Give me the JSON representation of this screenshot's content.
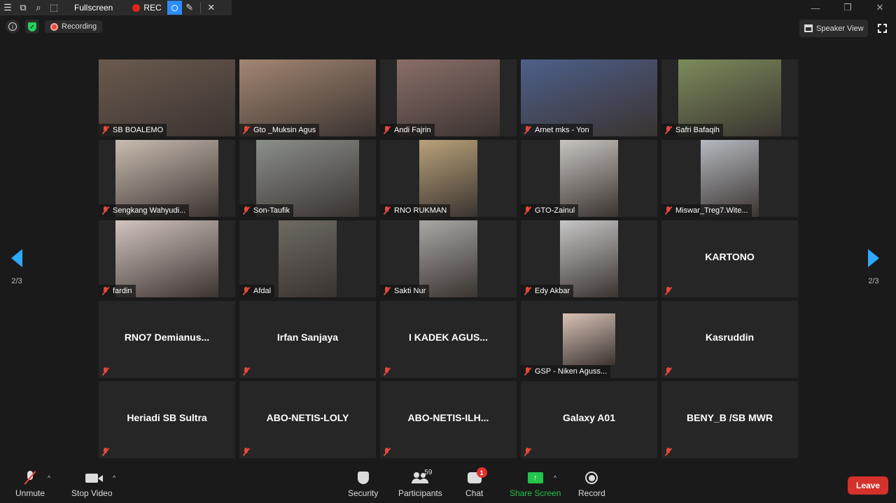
{
  "annotation_bar": {
    "fullscreen_label": "Fullscreen",
    "rec_label": "REC"
  },
  "status": {
    "recording_label": "Recording",
    "view_label": "Speaker View"
  },
  "pager": {
    "left_label": "2/3",
    "right_label": "2/3"
  },
  "participants": [
    {
      "name": "SB BOALEMO",
      "video": true,
      "bg": "#6b5a4e",
      "vx": 0,
      "vw": 195
    },
    {
      "name": "Gto _Muksin Agus",
      "video": true,
      "bg": "#a38672",
      "vx": 0,
      "vw": 195
    },
    {
      "name": "Andi Fajrin",
      "video": true,
      "bg": "#8a6e68",
      "vx": 24,
      "vw": 147
    },
    {
      "name": "Arnet mks - Yon",
      "video": true,
      "bg": "#4d5f8a",
      "vx": 0,
      "vw": 195
    },
    {
      "name": "Safri Bafaqih",
      "video": true,
      "bg": "#7c8b5a",
      "vx": 24,
      "vw": 147
    },
    {
      "name": "Sengkang Wahyudi...",
      "video": true,
      "bg": "#c9bcb0",
      "vx": 24,
      "vw": 147
    },
    {
      "name": "Son-Taufik",
      "video": true,
      "bg": "#8b8f8a",
      "vx": 24,
      "vw": 147
    },
    {
      "name": "RNO RUKMAN",
      "video": true,
      "bg": "#b9a27a",
      "vx": 56,
      "vw": 83
    },
    {
      "name": "GTO-Zainul",
      "video": true,
      "bg": "#c8c4c0",
      "vx": 56,
      "vw": 83
    },
    {
      "name": "Miswar_Treg7.Wite...",
      "video": true,
      "bg": "#b5b9c0",
      "vx": 56,
      "vw": 83
    },
    {
      "name": "fardin",
      "video": true,
      "bg": "#d2c4bf",
      "vx": 24,
      "vw": 147
    },
    {
      "name": "Afdal",
      "video": true,
      "bg": "#6e6a63",
      "vx": 56,
      "vw": 83
    },
    {
      "name": "Sakti Nur",
      "video": true,
      "bg": "#a9a7a4",
      "vx": 56,
      "vw": 83
    },
    {
      "name": "Edy Akbar",
      "video": true,
      "bg": "#c6c6c6",
      "vx": 56,
      "vw": 83
    },
    {
      "name": "KARTONO",
      "video": false
    },
    {
      "name": "RNO7  Demianus...",
      "video": false
    },
    {
      "name": "Irfan Sanjaya",
      "video": false
    },
    {
      "name": "I  KADEK AGUS...",
      "video": false
    },
    {
      "name": "GSP - Niken Aguss...",
      "video": true,
      "bg": "#d9c3b7",
      "vx": 60,
      "vw": 75,
      "photo": true
    },
    {
      "name": "Kasruddin",
      "video": false
    },
    {
      "name": "Heriadi SB Sultra",
      "video": false
    },
    {
      "name": "ABO-NETIS-LOLY",
      "video": false
    },
    {
      "name": "ABO-NETIS-ILH...",
      "video": false
    },
    {
      "name": "Galaxy A01",
      "video": false
    },
    {
      "name": "BENY_B /SB MWR",
      "video": false
    }
  ],
  "toolbar": {
    "unmute": "Unmute",
    "stop_video": "Stop Video",
    "security": "Security",
    "participants": "Participants",
    "participant_count": "59",
    "chat": "Chat",
    "chat_badge": "1",
    "share_screen": "Share Screen",
    "record": "Record",
    "leave": "Leave"
  },
  "colors": {
    "accent_blue": "#2da9ff",
    "share_green": "#23c44a",
    "leave_red": "#d5312a",
    "muted_red": "#e5483b"
  }
}
